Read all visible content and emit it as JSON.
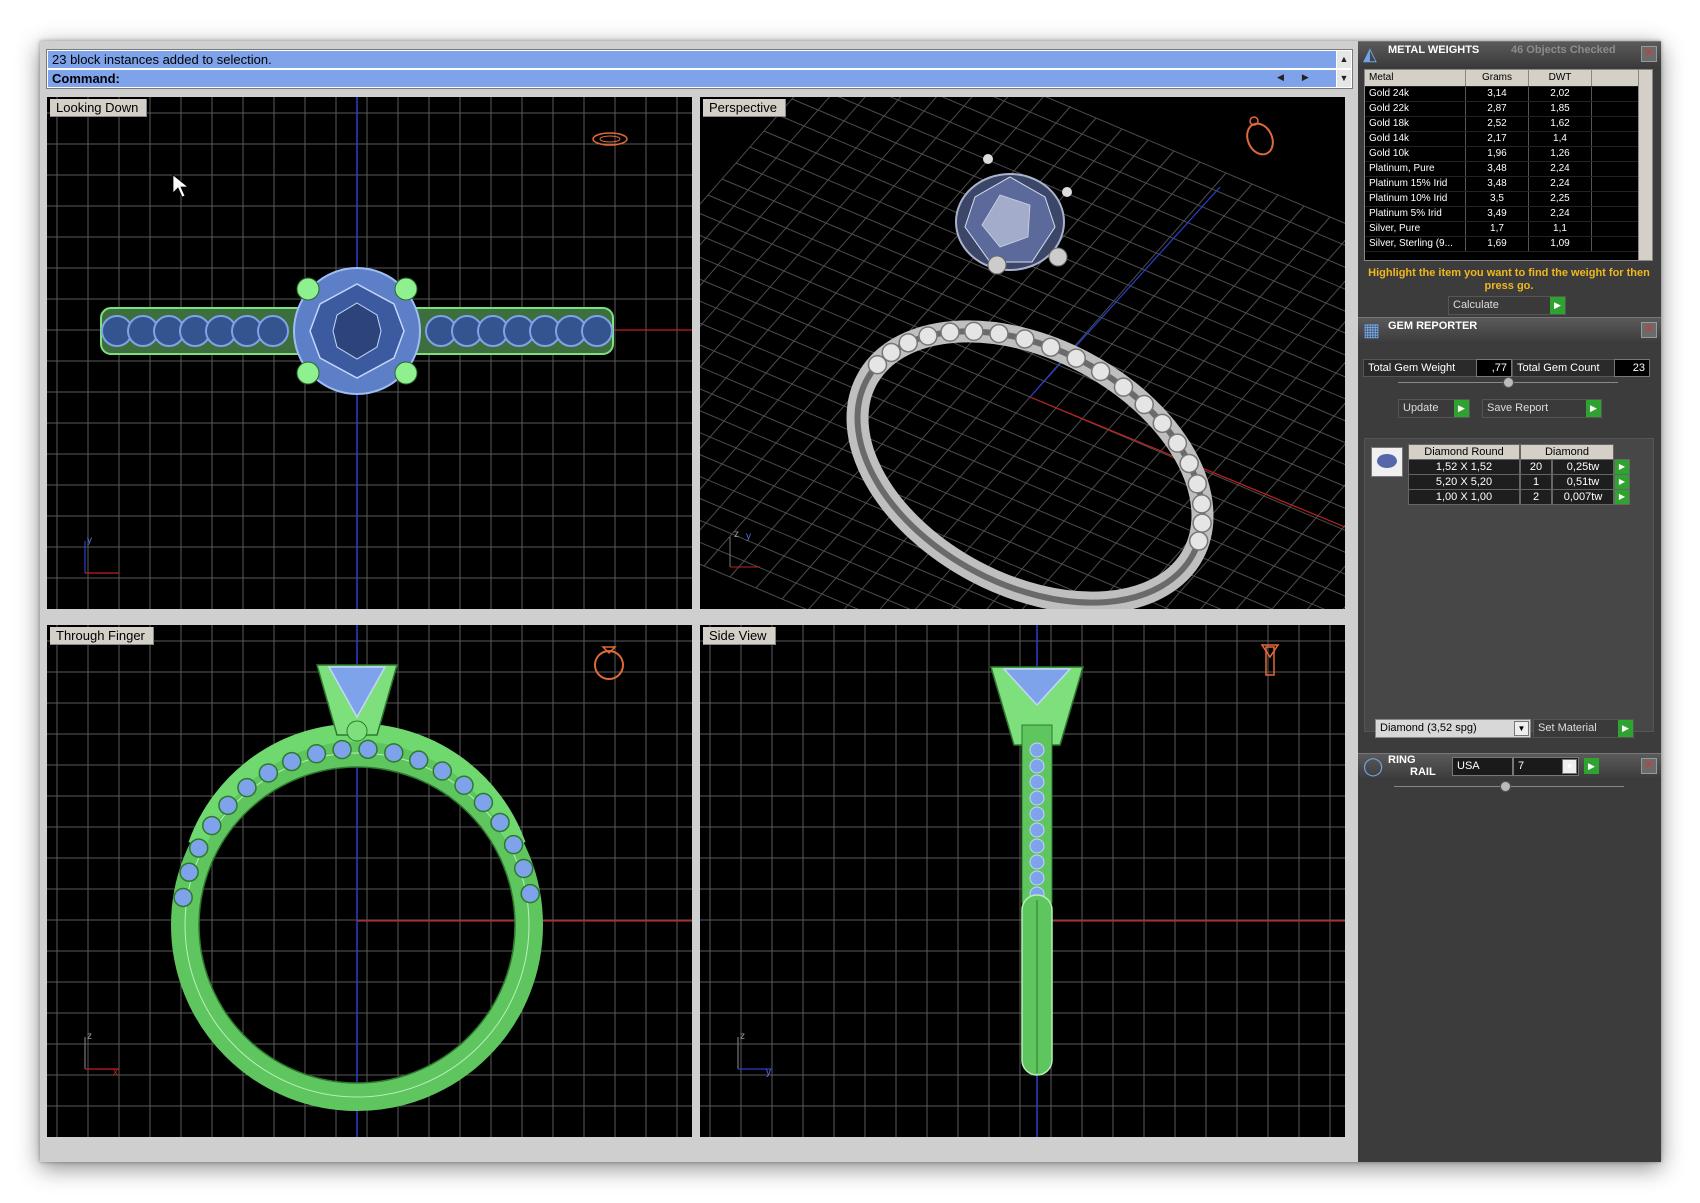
{
  "command": {
    "history_line": "23 block instances added to selection.",
    "prompt_label": "Command:",
    "input_value": ""
  },
  "viewports": [
    {
      "id": "top",
      "title": "Looking Down"
    },
    {
      "id": "perspective",
      "title": "Perspective"
    },
    {
      "id": "front",
      "title": "Through Finger"
    },
    {
      "id": "right",
      "title": "Side View"
    }
  ],
  "axis_labels": {
    "y": "y",
    "x": "x",
    "z": "z"
  },
  "metal_weights": {
    "title": "METAL WEIGHTS",
    "objects_checked": "46 Objects Checked",
    "columns": [
      "Metal",
      "Grams",
      "DWT"
    ],
    "rows": [
      [
        "Gold 24k",
        "3,14",
        "2,02"
      ],
      [
        "Gold 22k",
        "2,87",
        "1,85"
      ],
      [
        "Gold 18k",
        "2,52",
        "1,62"
      ],
      [
        "Gold 14k",
        "2,17",
        "1,4"
      ],
      [
        "Gold 10k",
        "1,96",
        "1,26"
      ],
      [
        "Platinum, Pure",
        "3,48",
        "2,24"
      ],
      [
        "Platinum 15% Irid",
        "3,48",
        "2,24"
      ],
      [
        "Platinum 10% Irid",
        "3,5",
        "2,25"
      ],
      [
        "Platinum 5% Irid",
        "3,49",
        "2,24"
      ],
      [
        "Silver, Pure",
        "1,7",
        "1,1"
      ],
      [
        "Silver, Sterling (9...",
        "1,69",
        "1,09"
      ]
    ],
    "hint": "Highlight the item you want to find the weight for then press go.",
    "calculate_label": "Calculate"
  },
  "gem_reporter": {
    "title": "GEM REPORTER",
    "total_weight_label": "Total Gem Weight",
    "total_weight_value": ",77",
    "total_count_label": "Total Gem Count",
    "total_count_value": "23",
    "update_label": "Update",
    "save_report_label": "Save Report",
    "table_headers": [
      "Diamond Round",
      "Diamond"
    ],
    "rows": [
      [
        "1,52 X 1,52",
        "20",
        "0,25tw"
      ],
      [
        "5,20 X 5,20",
        "1",
        "0,51tw"
      ],
      [
        "1,00 X 1,00",
        "2",
        "0,007tw"
      ]
    ],
    "material_value": "Diamond    (3,52 spg)",
    "set_material_label": "Set Material"
  },
  "ring_rail": {
    "title_line1": "RING",
    "title_line2": "RAIL",
    "country_value": "USA",
    "size_value": "7"
  },
  "icons": {
    "go": "play-arrow-icon",
    "close": "close-x-icon",
    "metal": "metal-weights-icon",
    "gem": "gem-reporter-icon",
    "rail": "ring-rail-icon"
  },
  "colors": {
    "viewport_bg": "#000000",
    "grid": "#5a5a5a",
    "wire_blue": "#7fa3ea",
    "wire_green": "#7de07d",
    "axis_red": "#c02020",
    "axis_blue": "#2a3fd0",
    "hint_yellow": "#f0b81e",
    "go_green": "#2fa32f"
  }
}
